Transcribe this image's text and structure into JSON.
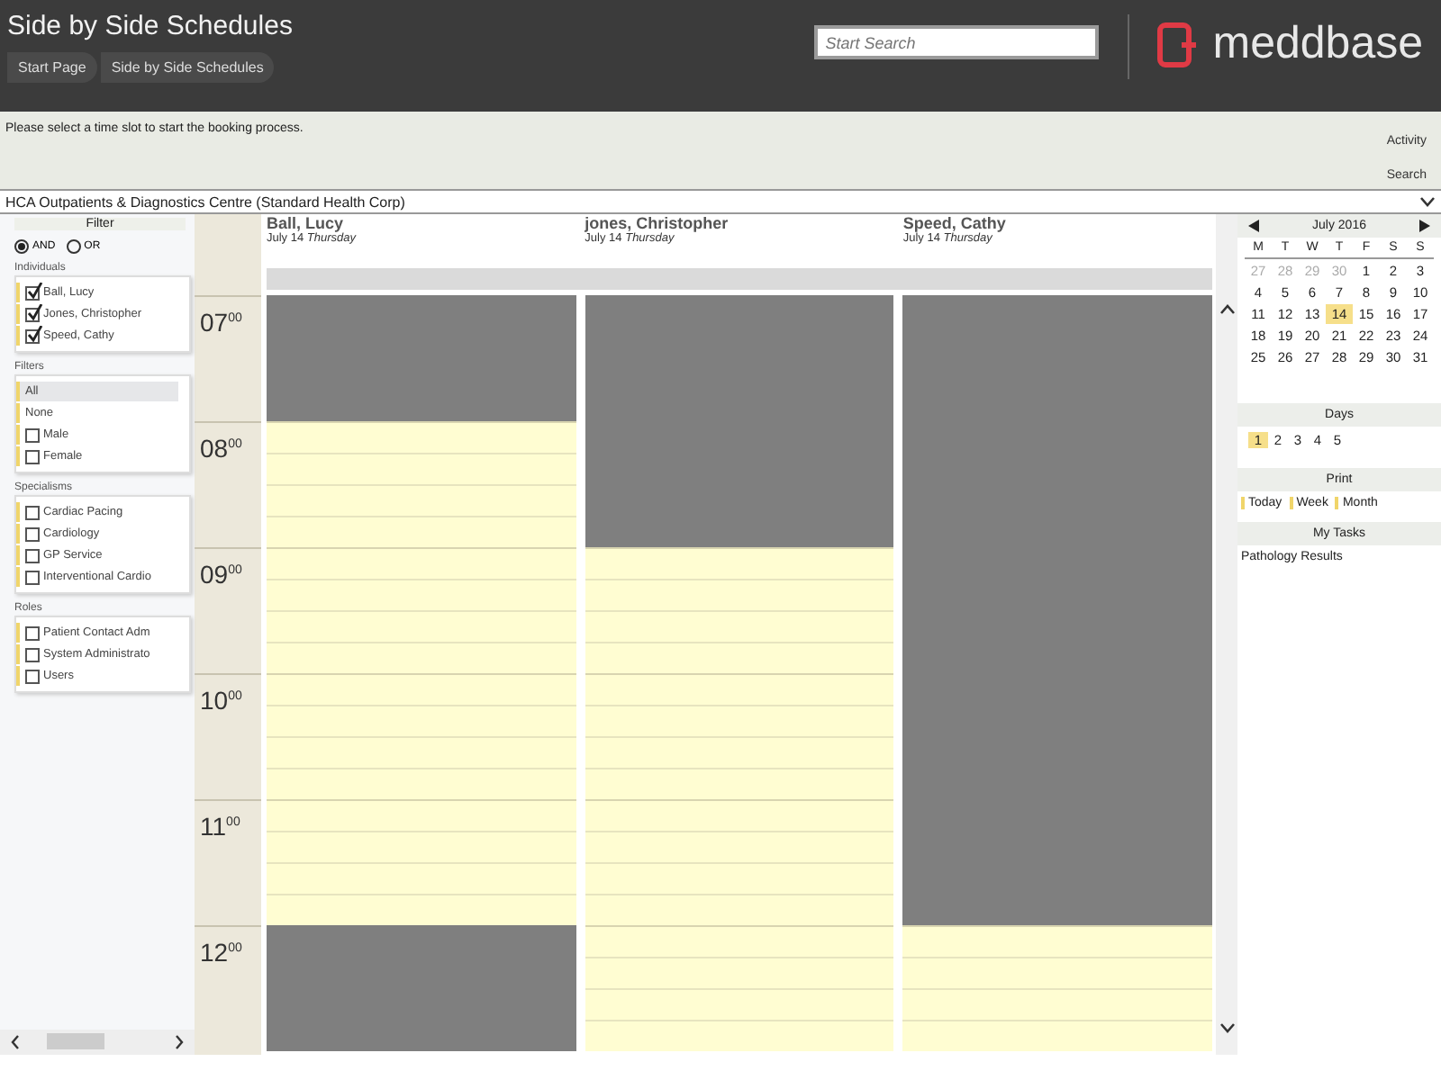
{
  "header": {
    "title": "Side by Side Schedules",
    "breadcrumbs": [
      "Start Page",
      "Side by Side Schedules"
    ],
    "search": {
      "placeholder": "Start Search"
    },
    "logo": "meddbase"
  },
  "info_bar": {
    "message": "Please select a time slot to start the booking process.",
    "links": [
      "Activity",
      "Search"
    ]
  },
  "location": {
    "value": "HCA Outpatients & Diagnostics Centre (Standard Health Corp)"
  },
  "filter": {
    "title": "Filter",
    "modes": [
      {
        "label": "AND",
        "selected": true
      },
      {
        "label": "OR",
        "selected": false
      }
    ],
    "groups": [
      {
        "title": "Individuals",
        "items": [
          {
            "kind": "checkbox",
            "label": "Ball, Lucy",
            "checked": true
          },
          {
            "kind": "checkbox",
            "label": "Jones, Christopher",
            "checked": true
          },
          {
            "kind": "checkbox",
            "label": "Speed, Cathy",
            "checked": true
          }
        ]
      },
      {
        "title": "Filters",
        "items": [
          {
            "kind": "option",
            "label": "All",
            "selected": true
          },
          {
            "kind": "option",
            "label": "None",
            "selected": false
          },
          {
            "kind": "checkbox",
            "label": "Male",
            "checked": false
          },
          {
            "kind": "checkbox",
            "label": "Female",
            "checked": false
          }
        ]
      },
      {
        "title": "Specialisms",
        "items": [
          {
            "kind": "checkbox",
            "label": "Cardiac Pacing",
            "checked": false
          },
          {
            "kind": "checkbox",
            "label": "Cardiology",
            "checked": false
          },
          {
            "kind": "checkbox",
            "label": "GP Service",
            "checked": false
          },
          {
            "kind": "checkbox",
            "label": "Interventional Cardio",
            "checked": false
          }
        ]
      },
      {
        "title": "Roles",
        "items": [
          {
            "kind": "checkbox",
            "label": "Patient Contact Adm",
            "checked": false
          },
          {
            "kind": "checkbox",
            "label": "System Administrato",
            "checked": false
          },
          {
            "kind": "checkbox",
            "label": "Users",
            "checked": false
          }
        ]
      }
    ]
  },
  "schedule": {
    "times": [
      "07$^{00}$",
      "08$^{00}$",
      "09$^{00}$",
      "10$^{00}$",
      "11$^{00}$",
      "12$^{00}$"
    ],
    "columns": [
      {
        "name": "Ball, Lucy",
        "date": "July 14",
        "day": "Thursday",
        "hours": [
          {
            "available": false
          },
          {
            "available": true
          },
          {
            "available": true
          },
          {
            "available": true
          },
          {
            "available": true
          },
          {
            "available": false
          }
        ]
      },
      {
        "name": "jones, Christopher",
        "date": "July 14",
        "day": "Thursday",
        "hours": [
          {
            "available": false
          },
          {
            "available": false
          },
          {
            "available": true
          },
          {
            "available": true
          },
          {
            "available": true
          },
          {
            "available": true
          }
        ]
      },
      {
        "name": "Speed, Cathy",
        "date": "July 14",
        "day": "Thursday",
        "hours": [
          {
            "available": false
          },
          {
            "available": false
          },
          {
            "available": false
          },
          {
            "available": false
          },
          {
            "available": false
          },
          {
            "available": true
          }
        ]
      }
    ]
  },
  "calendar": {
    "month": "July 2016",
    "weekdays": [
      "M",
      "T",
      "W",
      "T",
      "F",
      "S",
      "S"
    ],
    "weeks": [
      [
        {
          "day": "27",
          "muted": true,
          "selected": false
        },
        {
          "day": "28",
          "muted": true,
          "selected": false
        },
        {
          "day": "29",
          "muted": true,
          "selected": false
        },
        {
          "day": "30",
          "muted": true,
          "selected": false
        },
        {
          "day": "1",
          "muted": false,
          "selected": false
        },
        {
          "day": "2",
          "muted": false,
          "selected": false
        },
        {
          "day": "3",
          "muted": false,
          "selected": false
        }
      ],
      [
        {
          "day": "4",
          "muted": false,
          "selected": false
        },
        {
          "day": "5",
          "muted": false,
          "selected": false
        },
        {
          "day": "6",
          "muted": false,
          "selected": false
        },
        {
          "day": "7",
          "muted": false,
          "selected": false
        },
        {
          "day": "8",
          "muted": false,
          "selected": false
        },
        {
          "day": "9",
          "muted": false,
          "selected": false
        },
        {
          "day": "10",
          "muted": false,
          "selected": false
        }
      ],
      [
        {
          "day": "11",
          "muted": false,
          "selected": false
        },
        {
          "day": "12",
          "muted": false,
          "selected": false
        },
        {
          "day": "13",
          "muted": false,
          "selected": false
        },
        {
          "day": "14",
          "muted": false,
          "selected": true
        },
        {
          "day": "15",
          "muted": false,
          "selected": false
        },
        {
          "day": "16",
          "muted": false,
          "selected": false
        },
        {
          "day": "17",
          "muted": false,
          "selected": false
        }
      ],
      [
        {
          "day": "18",
          "muted": false,
          "selected": false
        },
        {
          "day": "19",
          "muted": false,
          "selected": false
        },
        {
          "day": "20",
          "muted": false,
          "selected": false
        },
        {
          "day": "21",
          "muted": false,
          "selected": false
        },
        {
          "day": "22",
          "muted": false,
          "selected": false
        },
        {
          "day": "23",
          "muted": false,
          "selected": false
        },
        {
          "day": "24",
          "muted": false,
          "selected": false
        }
      ],
      [
        {
          "day": "25",
          "muted": false,
          "selected": false
        },
        {
          "day": "26",
          "muted": false,
          "selected": false
        },
        {
          "day": "27",
          "muted": false,
          "selected": false
        },
        {
          "day": "28",
          "muted": false,
          "selected": false
        },
        {
          "day": "29",
          "muted": false,
          "selected": false
        },
        {
          "day": "30",
          "muted": false,
          "selected": false
        },
        {
          "day": "31",
          "muted": false,
          "selected": false
        }
      ]
    ]
  },
  "days": {
    "title": "Days",
    "items": [
      {
        "label": "1",
        "selected": true
      },
      {
        "label": "2",
        "selected": false
      },
      {
        "label": "3",
        "selected": false
      },
      {
        "label": "4",
        "selected": false
      },
      {
        "label": "5",
        "selected": false
      }
    ]
  },
  "print": {
    "title": "Print",
    "options": [
      "Today",
      "Week",
      "Month"
    ]
  },
  "tasks": {
    "title": "My Tasks",
    "items": [
      "Pathology Results"
    ]
  }
}
